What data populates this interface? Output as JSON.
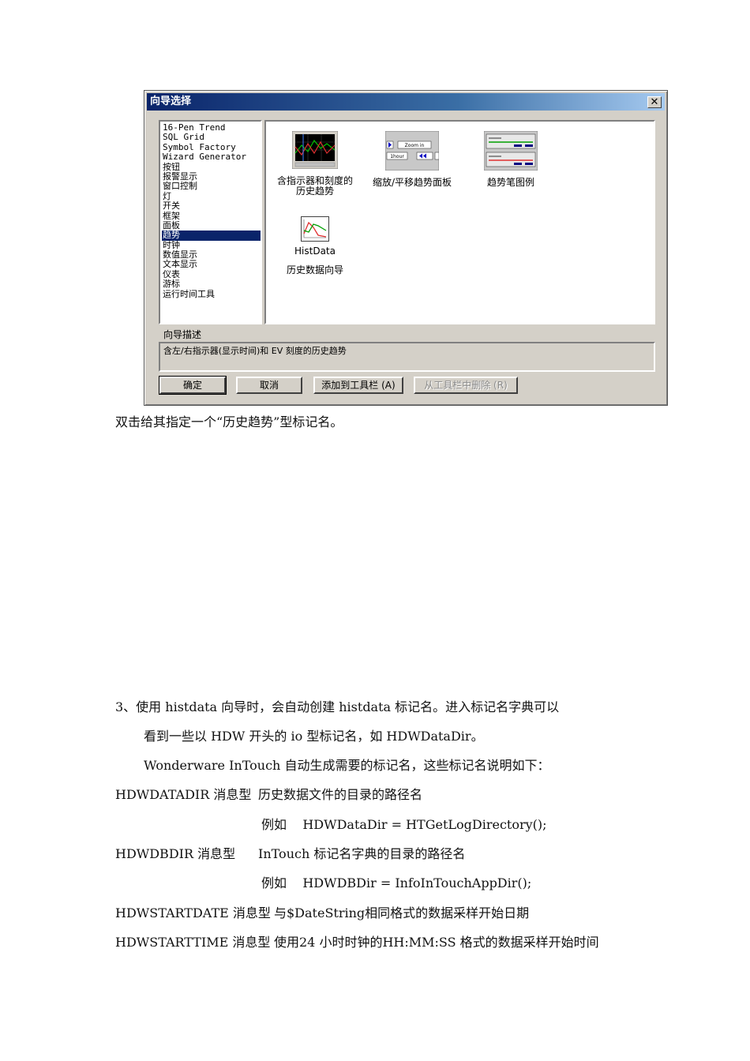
{
  "dialog": {
    "title": "向导选择",
    "close_glyph": "✕",
    "list_items": [
      "16-Pen Trend",
      "SQL Grid",
      "Symbol Factory",
      "Wizard Generator",
      "按钮",
      "报警显示",
      "窗口控制",
      "灯",
      "开关",
      "框架",
      "面板",
      "趋势",
      "时钟",
      "数值显示",
      "文本显示",
      "仪表",
      "游标",
      "运行时间工具"
    ],
    "selected_index": 11,
    "wizards": [
      {
        "label_line1": "含指示器和刻度的",
        "label_line2": "历史趋势"
      },
      {
        "label_line1": "缩放/平移趋势面板",
        "label_line2": "",
        "thumb_zoom": "Zoom in",
        "thumb_hour": "1hour"
      },
      {
        "label_line1": "趋势笔图例",
        "label_line2": ""
      },
      {
        "label_line1": "HistData",
        "label_line2": "历史数据向导"
      }
    ],
    "desc_label": "向导描述",
    "desc_text": "含左/右指示器(显示时间)和 EV 刻度的历史趋势",
    "buttons": {
      "ok": "确定",
      "cancel": "取消",
      "add": "添加到工具栏 (A)",
      "remove": "从工具栏中删除 (R)"
    }
  },
  "doc": {
    "caption": "双击给其指定一个“历史趋势”型标记名。",
    "para3_line1": "3、使用 histdata 向导时，会自动创建 histdata 标记名。进入标记名字典可以",
    "para3_line2": "看到一些以 HDW 开头的 io 型标记名，如 HDWDataDir。",
    "intro": "Wonderware InTouch 自动生成需要的标记名，这些标记名说明如下：",
    "tags": [
      {
        "name": "HDWDATADIR 消息型",
        "desc": "历史数据文件的目录的路径名",
        "example": "例如    HDWDataDir = HTGetLogDirectory();"
      },
      {
        "name": "HDWDBDIR 消息型",
        "desc": "InTouch 标记名字典的目录的路径名",
        "example": "例如    HDWDBDir = InfoInTouchAppDir();"
      },
      {
        "name": "HDWSTARTDATE 消息型",
        "desc": "与$DateString相同格式的数据采样开始日期",
        "example": ""
      },
      {
        "name": "HDWSTARTTIME 消息型",
        "desc": "使用24 小时时钟的HH:MM:SS 格式的数据采样开始时间",
        "example": ""
      }
    ]
  }
}
